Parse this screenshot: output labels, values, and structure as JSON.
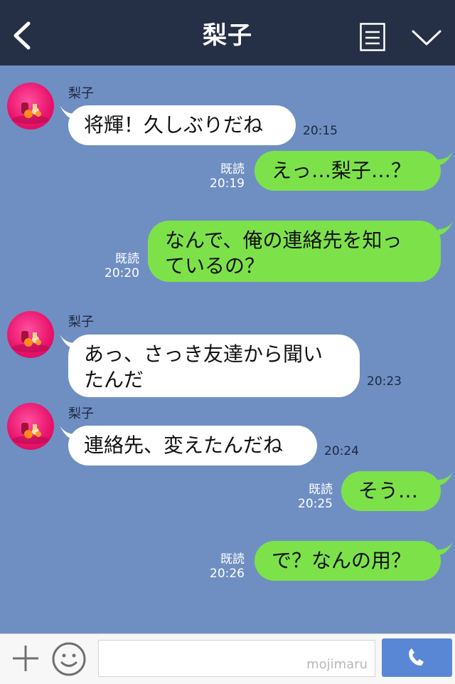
{
  "header": {
    "title": "梨子"
  },
  "messages": [
    {
      "side": "in",
      "sender": "梨子",
      "text": "将輝！久しぶりだね",
      "time": "20:15"
    },
    {
      "side": "out",
      "read": "既読",
      "text": "えっ…梨子…？",
      "time": "20:19"
    },
    {
      "side": "out",
      "read": "既読",
      "text_l1": "なんで、俺の連絡先を知っ",
      "text_l2": "ているの？",
      "time": "20:20"
    },
    {
      "side": "in",
      "sender": "梨子",
      "text_l1": "あっ、さっき友達から聞い",
      "text_l2": "たんだ",
      "time": "20:23"
    },
    {
      "side": "in",
      "sender": "梨子",
      "text": "連絡先、変えたんだね",
      "time": "20:24"
    },
    {
      "side": "out",
      "read": "既読",
      "text": "そう…",
      "time": "20:25"
    },
    {
      "side": "out",
      "read": "既読",
      "text": "で？なんの用？",
      "time": "20:26"
    }
  ],
  "footer": {
    "watermark": "mojimaru"
  }
}
